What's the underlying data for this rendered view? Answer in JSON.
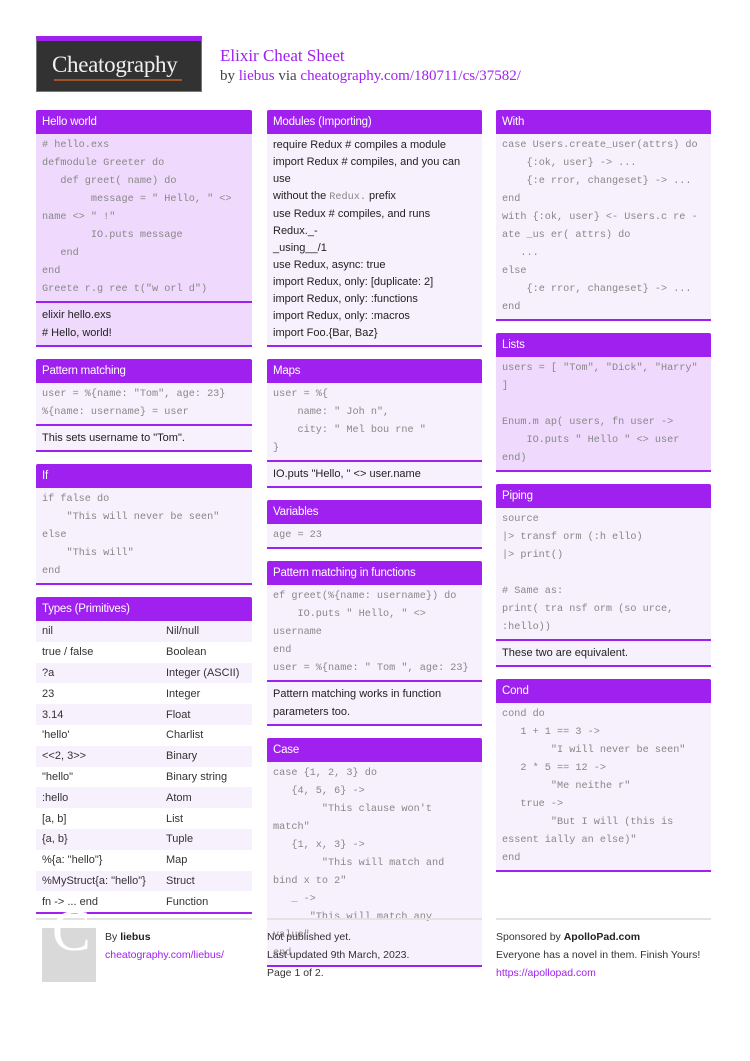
{
  "header": {
    "logo_text": "Cheatography",
    "title": "Elixir Cheat Sheet",
    "by_prefix": "by",
    "author": "liebus",
    "via": "via",
    "url": "cheatography.com/180711/cs/37582/"
  },
  "hello_world": {
    "title": "Hello world",
    "code": "# hello.exs\ndefmodule Greeter do\n   def greet( name) do\n        message = \" Hello, \" <>\nname <> \" !\"\n        IO.puts message\n   end\nend\nGreete r.g ree t(\"w orl d\")",
    "notes": [
      "elixir hello.exs",
      "# Hello, world!"
    ]
  },
  "pattern_matching": {
    "title": "Pattern matching",
    "code": "user = %{name: \"Tom\", age: 23}\n%{name: username} = user",
    "note": "This sets username to \"Tom\"."
  },
  "if": {
    "title": "If",
    "code": "if false do\n    \"This will never be seen\"\nelse\n    \"This will\"\nend"
  },
  "types": {
    "title": "Types (Primitives)",
    "rows": [
      {
        "k": "nil",
        "v": "Nil/null"
      },
      {
        "k": "true / false",
        "v": "Boolean"
      },
      {
        "k": "?a",
        "v": "Integer (ASCII)"
      },
      {
        "k": "23",
        "v": "Integer"
      },
      {
        "k": "3.14",
        "v": "Float"
      },
      {
        "k": "'hello'",
        "v": "Charlist"
      },
      {
        "k": "<<2, 3>>",
        "v": "Binary"
      },
      {
        "k": "\"hello\"",
        "v": "Binary string"
      },
      {
        "k": ":hello",
        "v": "Atom"
      },
      {
        "k": "[a, b]",
        "v": "List"
      },
      {
        "k": "{a, b}",
        "v": "Tuple"
      },
      {
        "k": "%{a: \"hello\"}",
        "v": "Map"
      },
      {
        "k": "%MyStruct{a: \"hello\"}",
        "v": "Struct"
      },
      {
        "k": "fn -> ... end",
        "v": "Function"
      }
    ]
  },
  "modules": {
    "title": "Modules (Importing)",
    "lines": [
      "require Redux # compiles a module",
      "import Redux # compiles, and you can use",
      "without the",
      "Redux.",
      "prefix",
      "use Redux # compiles, and runs Redux._-",
      "_using__/1",
      "use Redux, async: true",
      "import Redux, only: [duplicate: 2]",
      "import Redux, only: :functions",
      "import Redux, only: :macros",
      "import Foo.{Bar, Baz}"
    ]
  },
  "maps": {
    "title": "Maps",
    "code": "user = %{\n    name: \" Joh n\",\n    city: \" Mel bou rne \"\n}",
    "note": "IO.puts \"Hello, \" <> user.name"
  },
  "variables": {
    "title": "Variables",
    "code": "age = 23"
  },
  "pm_functions": {
    "title": "Pattern matching in functions",
    "code": "ef greet(%{name: username}) do\n    IO.puts \" Hello, \" <>\nusername\nend\nuser = %{name: \" Tom \", age: 23}",
    "note": "Pattern matching works in function parameters too."
  },
  "case": {
    "title": "Case",
    "code": "case {1, 2, 3} do\n   {4, 5, 6} ->\n        \"This clause won't\nmatch\"\n   {1, x, 3} ->\n        \"This will match and\nbind x to 2\"\n   _ ->\n      \"This will match any\nvalue\"\nend"
  },
  "with": {
    "title": "With",
    "code": "case Users.create_user(attrs) do\n    {:ok, user} -> ...\n    {:e rror, changeset} -> ...\nend\nwith {:ok, user} <- Users.c re -\nate _us er( attrs) do\n   ...\nelse\n    {:e rror, changeset} -> ...\nend"
  },
  "lists": {
    "title": "Lists",
    "code": "users = [ \"Tom\", \"Dick\", \"Harry\"\n]\n\nEnum.m ap( users, fn user ->\n    IO.puts \" Hello \" <> user\nend)"
  },
  "piping": {
    "title": "Piping",
    "code": "source\n|> transf orm (:h ello)\n|> print()\n\n# Same as:\nprint( tra nsf orm (so urce,\n:hello))",
    "note": "These two are equivalent."
  },
  "cond": {
    "title": "Cond",
    "code": "cond do\n   1 + 1 == 3 ->\n        \"I will never be seen\"\n   2 * 5 == 12 ->\n        \"Me neithe r\"\n   true ->\n        \"But I will (this is\nessent ially an else)\"\nend"
  },
  "footer": {
    "avatar_letter": "C",
    "by": "By",
    "author": "liebus",
    "author_url": "cheatography.com/liebus/",
    "published": "Not published yet.",
    "updated": "Last updated 9th March, 2023.",
    "page": "Page 1 of 2.",
    "sponsored_prefix": "Sponsored by",
    "sponsor": "ApolloPad.com",
    "sponsor_text": "Everyone has a novel in them. Finish Yours!",
    "sponsor_url": "https://apollopad.com"
  }
}
